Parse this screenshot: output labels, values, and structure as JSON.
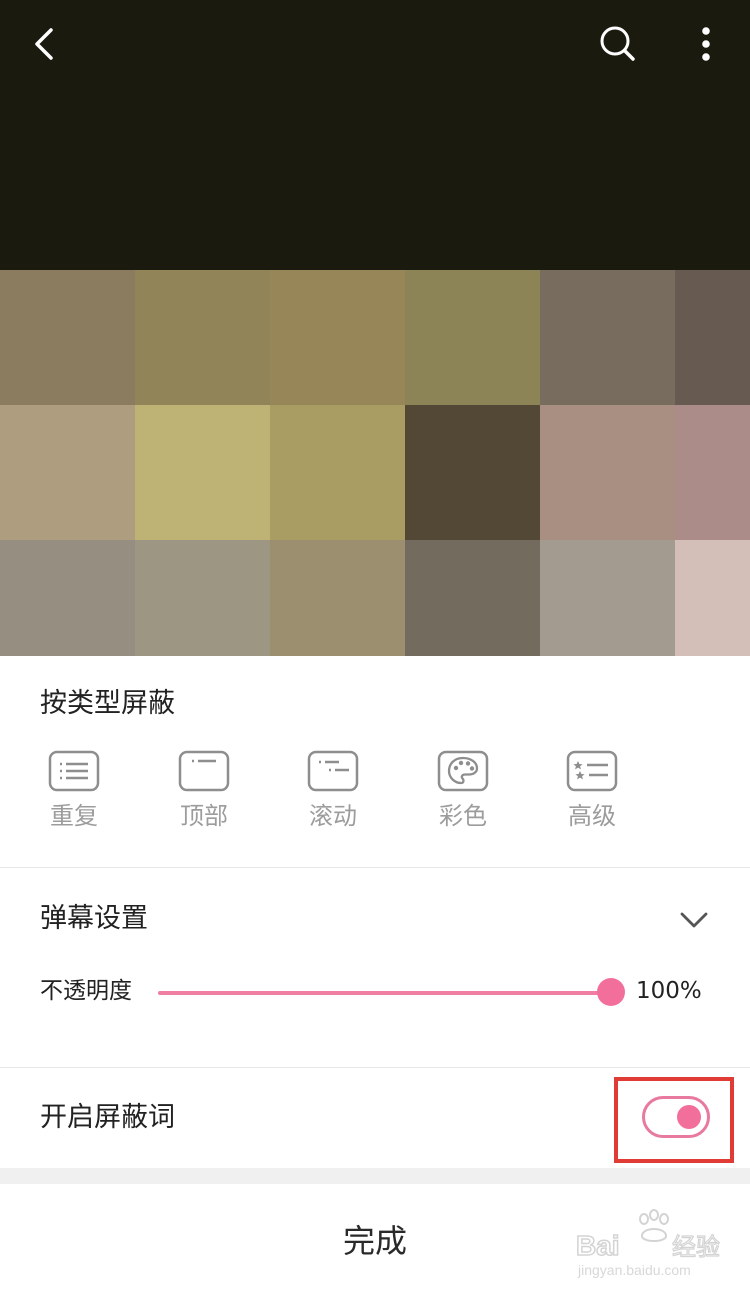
{
  "top_bar": {
    "icons": [
      "back-arrow-icon",
      "search-icon",
      "more-vertical-icon"
    ]
  },
  "colors": {
    "accent": "#f36f9b",
    "highlight": "#e03b34",
    "video_background": "#1b1a0f",
    "icon_gray": "#8e8e8e",
    "mosaic": [
      [
        "#8b7c5f",
        "#918458",
        "#978758",
        "#8c8356",
        "#776c5e",
        "#675a50"
      ],
      [
        "#ae9d7e",
        "#beb274",
        "#aa9d63",
        "#534835",
        "#a88f82",
        "#ac8c88"
      ],
      [
        "#958e81",
        "#9d9682",
        "#9b8f6f",
        "#746b5f",
        "#a39b8f",
        "#d3beb8"
      ]
    ]
  },
  "block_by_type": {
    "title": "按类型屏蔽",
    "items": [
      {
        "label": "重复",
        "icon": "repeat-danmaku-icon"
      },
      {
        "label": "顶部",
        "icon": "top-danmaku-icon"
      },
      {
        "label": "滚动",
        "icon": "scroll-danmaku-icon"
      },
      {
        "label": "彩色",
        "icon": "palette-icon"
      },
      {
        "label": "高级",
        "icon": "advanced-danmaku-icon"
      }
    ]
  },
  "danmaku_settings": {
    "title": "弹幕设置",
    "opacity_label": "不透明度",
    "opacity_value": "100%",
    "opacity_fraction": 1.0
  },
  "block_words": {
    "label": "开启屏蔽词",
    "enabled": true
  },
  "footer": {
    "done_label": "完成"
  },
  "watermark": {
    "text": "Bai 经验",
    "url_text": "jingyan.baidu.com"
  }
}
